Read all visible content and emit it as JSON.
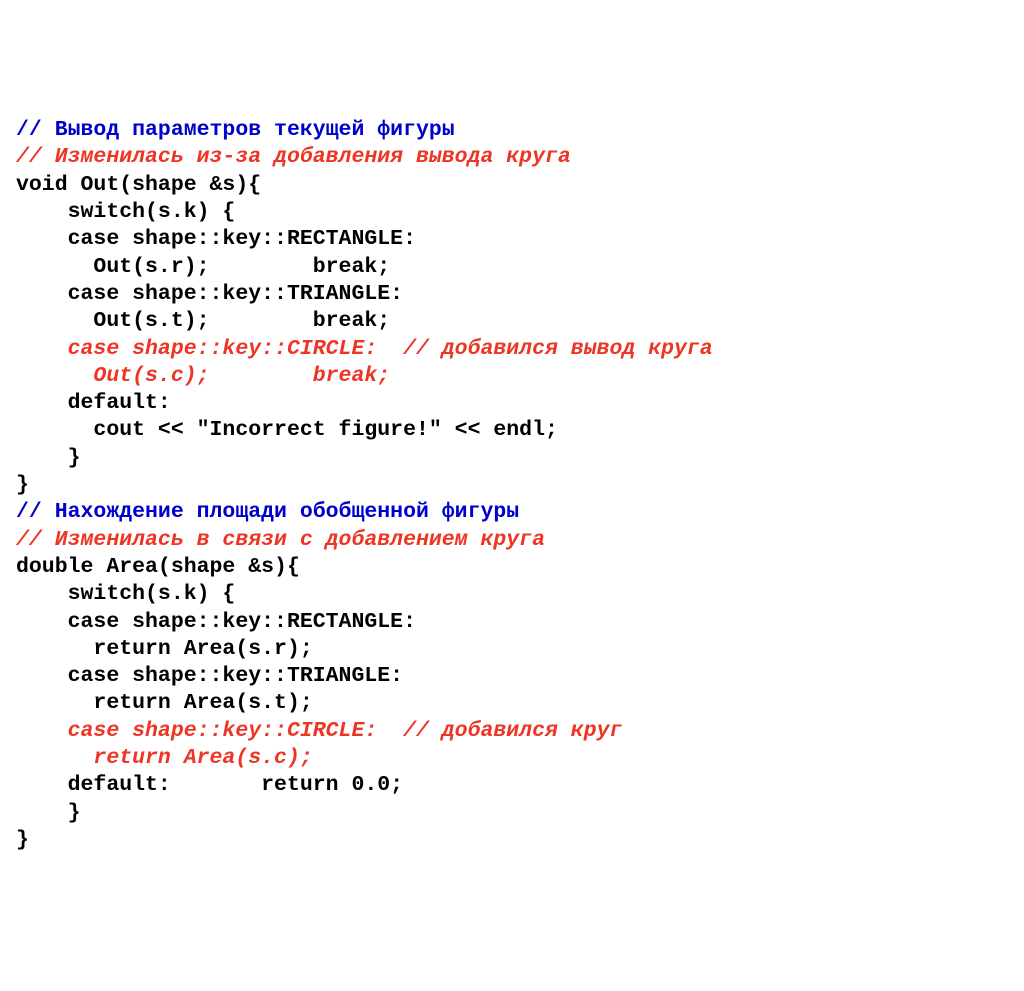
{
  "lines": [
    {
      "id": "l01",
      "cls": "blue",
      "text": "// Вывод параметров текущей фигуры"
    },
    {
      "id": "l02",
      "cls": "orange",
      "text": "// Изменилась из-за добавления вывода круга"
    },
    {
      "id": "l03",
      "cls": "black",
      "text": "void Out(shape &s){"
    },
    {
      "id": "l04",
      "cls": "black",
      "text": "    switch(s.k) {"
    },
    {
      "id": "l05",
      "cls": "black",
      "text": "    case shape::key::RECTANGLE:"
    },
    {
      "id": "l06",
      "cls": "black",
      "text": "      Out(s.r);        break;"
    },
    {
      "id": "l07",
      "cls": "black",
      "text": "    case shape::key::TRIANGLE:"
    },
    {
      "id": "l08",
      "cls": "black",
      "text": "      Out(s.t);        break;"
    },
    {
      "id": "l09",
      "cls": "orange",
      "text": "    case shape::key::CIRCLE:  // добавился вывод круга"
    },
    {
      "id": "l10",
      "cls": "orange",
      "text": "      Out(s.c);        break;"
    },
    {
      "id": "l11",
      "cls": "black",
      "text": "    default:"
    },
    {
      "id": "l12",
      "cls": "black",
      "text": "      cout << \"Incorrect figure!\" << endl;"
    },
    {
      "id": "l13",
      "cls": "black",
      "text": "    }"
    },
    {
      "id": "l14",
      "cls": "black",
      "text": "}"
    },
    {
      "id": "l15",
      "cls": "blue",
      "text": "// Нахождение площади обобщенной фигуры"
    },
    {
      "id": "l16",
      "cls": "orange",
      "text": "// Изменилась в связи с добавлением круга"
    },
    {
      "id": "l17",
      "cls": "black",
      "text": "double Area(shape &s){"
    },
    {
      "id": "l18",
      "cls": "black",
      "text": "    switch(s.k) {"
    },
    {
      "id": "l19",
      "cls": "black",
      "text": "    case shape::key::RECTANGLE:"
    },
    {
      "id": "l20",
      "cls": "black",
      "text": "      return Area(s.r);"
    },
    {
      "id": "l21",
      "cls": "black",
      "text": "    case shape::key::TRIANGLE:"
    },
    {
      "id": "l22",
      "cls": "black",
      "text": "      return Area(s.t);"
    },
    {
      "id": "l23",
      "cls": "orange",
      "text": "    case shape::key::CIRCLE:  // добавился круг"
    },
    {
      "id": "l24",
      "cls": "orange",
      "text": "      return Area(s.c);"
    },
    {
      "id": "l25",
      "cls": "black",
      "text": "    default:       return 0.0;"
    },
    {
      "id": "l26",
      "cls": "black",
      "text": "    }"
    },
    {
      "id": "l27",
      "cls": "black",
      "text": "}"
    }
  ]
}
